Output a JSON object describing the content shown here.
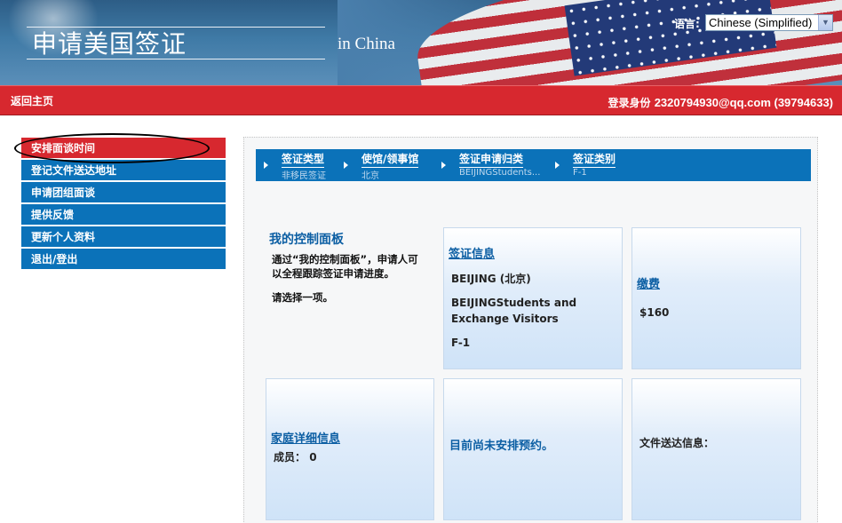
{
  "header": {
    "site_title": "申请美国签证",
    "region": "in China",
    "language_label": "语言:",
    "language_selected": "Chinese (Simplified)"
  },
  "navbar": {
    "home": "返回主页",
    "login_label": "登录身份",
    "login_value": "2320794930@qq.com (39794633)"
  },
  "sidebar": {
    "items": [
      {
        "label": "安排面谈时间"
      },
      {
        "label": "登记文件送达地址"
      },
      {
        "label": "申请团组面谈"
      },
      {
        "label": "提供反馈"
      },
      {
        "label": "更新个人资料"
      },
      {
        "label": "退出/登出"
      }
    ]
  },
  "breadcrumb": [
    {
      "title": "签证类型",
      "value": "非移民签证"
    },
    {
      "title": "使馆/领事馆",
      "value": "北京"
    },
    {
      "title": "签证申请归类",
      "value": "BEIJINGStudents..."
    },
    {
      "title": "签证类别",
      "value": "F-1"
    }
  ],
  "dashboard": {
    "title": "我的控制面板",
    "description": "通过“我的控制面板”，申请人可以全程跟踪签证申请进度。",
    "prompt": "请选择一项。"
  },
  "cards": {
    "visa_info": {
      "link": "签证信息",
      "post": "BEIJING (北京)",
      "category": "BEIJINGStudents and Exchange Visitors",
      "class": "F-1"
    },
    "payment": {
      "link": "缴费",
      "amount": "$160"
    },
    "family": {
      "link": "家庭详细信息",
      "members_label": "成员：",
      "members_value": "0"
    },
    "appointment": {
      "status": "目前尚未安排预约。"
    },
    "delivery": {
      "label": "文件送达信息："
    }
  },
  "colors": {
    "nav_red": "#d7282f",
    "nav_blue": "#0b72b9",
    "link_blue": "#0b5ea3"
  }
}
